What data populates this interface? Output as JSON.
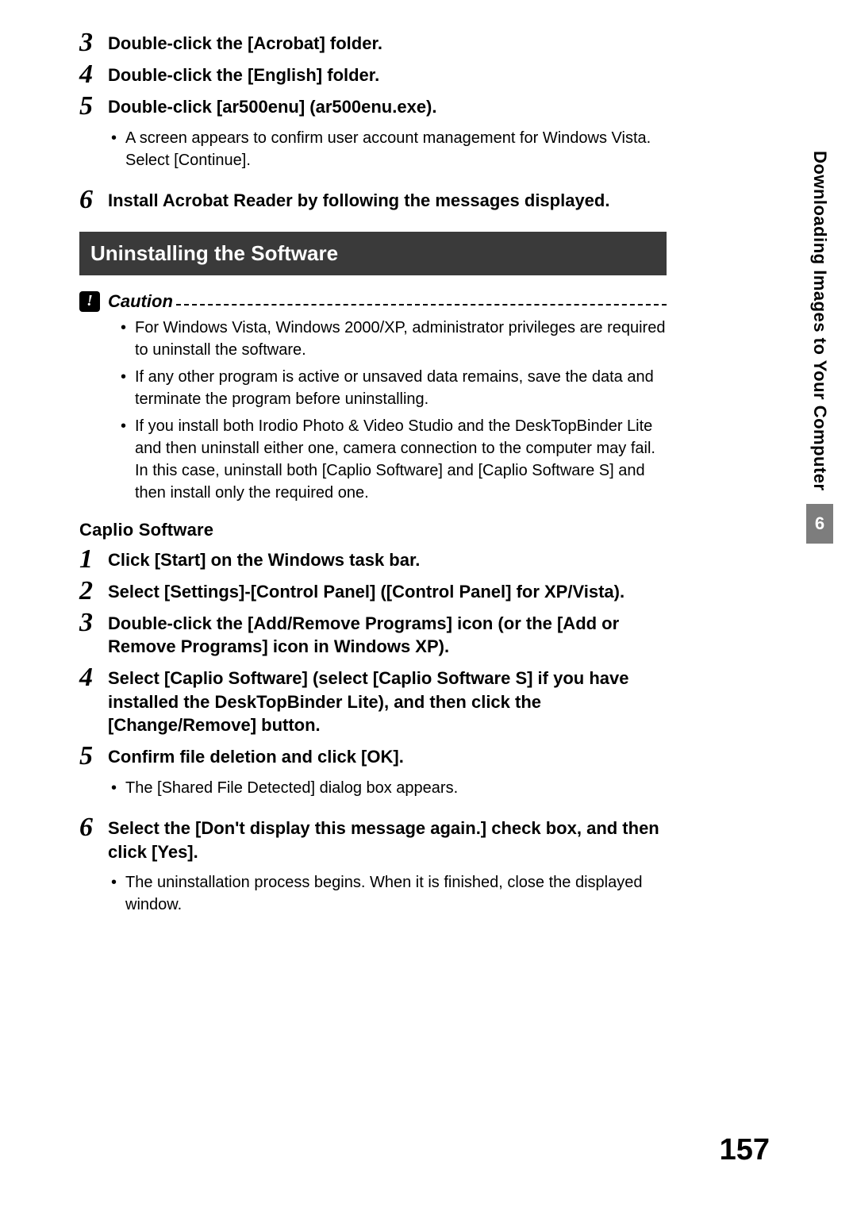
{
  "sideTab": {
    "text": "Downloading Images to Your Computer",
    "chapter": "6"
  },
  "pageNumber": "157",
  "topSteps": [
    {
      "num": "3",
      "text": "Double-click the [Acrobat] folder.",
      "bullets": []
    },
    {
      "num": "4",
      "text": "Double-click the [English] folder.",
      "bullets": []
    },
    {
      "num": "5",
      "text": "Double-click [ar500enu] (ar500enu.exe).",
      "bullets": [
        "A screen appears to confirm user account management for Windows Vista. Select [Continue]."
      ]
    },
    {
      "num": "6",
      "text": "Install Acrobat Reader by following the messages displayed.",
      "bullets": []
    }
  ],
  "sectionBar": "Uninstalling the Software",
  "caution": {
    "label": "Caution",
    "bullets": [
      "For Windows Vista, Windows 2000/XP, administrator privileges are required to uninstall the software.",
      "If any other program is active or unsaved data remains, save the data and terminate the program before uninstalling.",
      "If you install both Irodio Photo & Video Studio and the DeskTopBinder Lite and then uninstall either one, camera connection to the computer may fail. In this case, uninstall both [Caplio Software] and [Caplio Software S] and then install only the required one."
    ]
  },
  "subheading": "Caplio Software",
  "bottomSteps": [
    {
      "num": "1",
      "text": "Click [Start] on the Windows task bar.",
      "bullets": []
    },
    {
      "num": "2",
      "text": "Select [Settings]-[Control Panel] ([Control Panel] for XP/Vista).",
      "bullets": []
    },
    {
      "num": "3",
      "text": "Double-click the [Add/Remove Programs] icon (or the [Add or Remove Programs] icon in Windows XP).",
      "bullets": []
    },
    {
      "num": "4",
      "text": "Select [Caplio Software] (select [Caplio Software S] if you have installed the DeskTopBinder Lite), and then click the [Change/Remove] button.",
      "bullets": []
    },
    {
      "num": "5",
      "text": "Confirm file deletion and click [OK].",
      "bullets": [
        "The [Shared File Detected] dialog box appears."
      ]
    },
    {
      "num": "6",
      "text": "Select the [Don't display this message again.] check box, and then click [Yes].",
      "bullets": [
        "The uninstallation process begins. When it is finished, close the displayed window."
      ]
    }
  ]
}
